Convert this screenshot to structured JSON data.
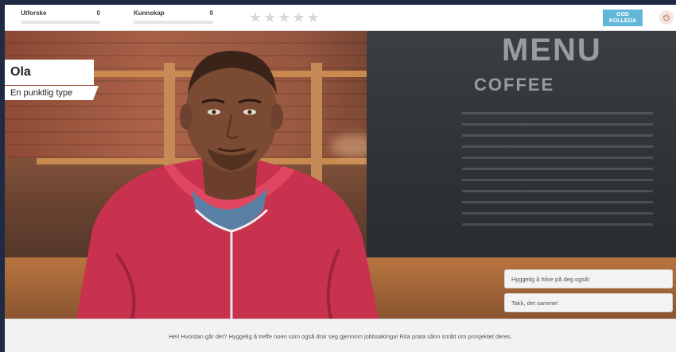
{
  "topbar": {
    "stats": [
      {
        "label": "Utforske",
        "value": "0",
        "progress": 0
      },
      {
        "label": "Kunnskap",
        "value": "0",
        "progress": 0
      }
    ],
    "rating": {
      "max": 5,
      "filled": 0
    },
    "logo": {
      "line1": "GOD",
      "line2": "KOLLEGA"
    }
  },
  "character": {
    "name": "Ola",
    "type": "En punktlig type"
  },
  "scene": {
    "chalkboard": {
      "line1": "MENU",
      "line2": "COFFEE"
    }
  },
  "answers": [
    "Hyggelig å hilse på deg også!",
    "Takk, det samme!"
  ],
  "dialogue": {
    "text": "Hei! Hvordan går det? Hyggelig å treffe noen som også drar seg gjennom jobbsøkinga! Rita prata sånn smått om prosjektet deres."
  },
  "colors": {
    "accent": "#62b7d8",
    "hoodie": "#d23a57",
    "skin": "#7a4a33"
  }
}
